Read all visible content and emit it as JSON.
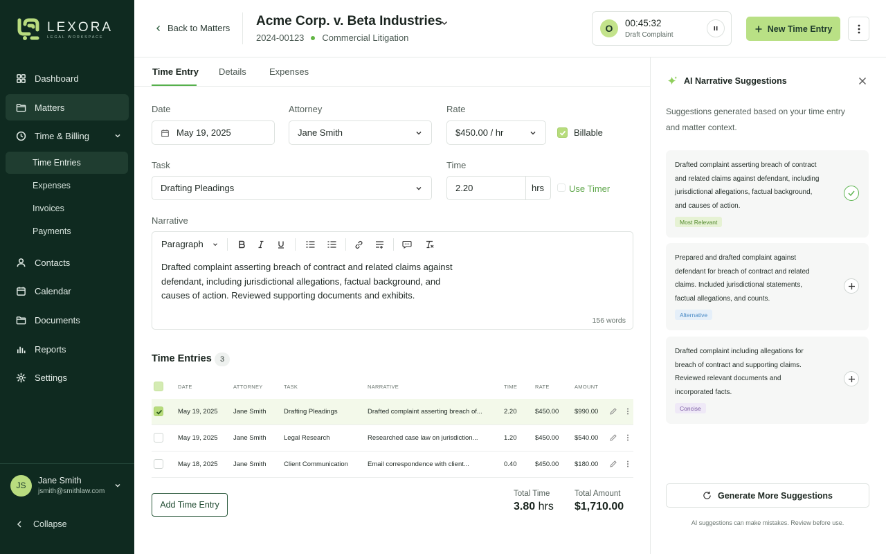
{
  "brand": {
    "name": "LEXORA",
    "tagline": "LEGAL WORKSPACE"
  },
  "nav": [
    {
      "label": "Dashboard",
      "icon": "grid-icon"
    },
    {
      "label": "Matters",
      "icon": "folder-icon",
      "active": true
    },
    {
      "label": "Time & Billing",
      "icon": "clock-icon",
      "expanded": true
    },
    {
      "label": "Contacts",
      "icon": "user-icon"
    },
    {
      "label": "Calendar",
      "icon": "calendar-icon"
    },
    {
      "label": "Documents",
      "icon": "folder-icon"
    },
    {
      "label": "Reports",
      "icon": "bar-chart-icon"
    },
    {
      "label": "Settings",
      "icon": "gear-icon"
    }
  ],
  "subnav": [
    {
      "label": "Time Entries",
      "active": true
    },
    {
      "label": "Expenses"
    },
    {
      "label": "Invoices"
    },
    {
      "label": "Payments"
    }
  ],
  "user": {
    "initials": "JS",
    "name": "Jane Smith",
    "email": "jsmith@smithlaw.com"
  },
  "collapse_label": "Collapse",
  "header": {
    "back_label": "Back to Matters",
    "matter_title": "Acme Corp. v. Beta Industries",
    "matter_number": "2024-00123",
    "practice_area": "Commercial Litigation",
    "timer": {
      "badge": "O",
      "time": "00:45:32",
      "description": "Draft Complaint"
    },
    "new_entry_label": "New Time Entry"
  },
  "tabs": [
    {
      "label": "Time Entry",
      "active": true
    },
    {
      "label": "Details"
    },
    {
      "label": "Expenses"
    }
  ],
  "form": {
    "date_label": "Date",
    "date_value": "May 19, 2025",
    "attorney_label": "Attorney",
    "attorney_value": "Jane Smith",
    "rate_label": "Rate",
    "rate_value": "$450.00 / hr",
    "billable_label": "Billable",
    "billable": true,
    "task_label": "Task",
    "task_value": "Drafting Pleadings",
    "time_label": "Time",
    "time_value": "2.20",
    "time_unit": "hrs",
    "use_timer_label": "Use Timer",
    "use_timer": false,
    "narrative_label": "Narrative",
    "paragraph_style": "Paragraph",
    "narrative_text": "Drafted complaint asserting breach of contract and related claims against\ndefendant, including jurisdictional allegations, factual background, and\ncauses of action. Reviewed supporting documents and exhibits.",
    "word_count": "156 words"
  },
  "entries": {
    "title": "Time Entries",
    "count": "3",
    "columns": [
      "DATE",
      "ATTORNEY",
      "TASK",
      "NARRATIVE",
      "TIME",
      "RATE",
      "AMOUNT"
    ],
    "rows": [
      {
        "checked": true,
        "date": "May 19, 2025",
        "attorney": "Jane Smith",
        "task": "Drafting Pleadings",
        "narrative": "Drafted complaint asserting breach of...",
        "time": "2.20",
        "rate": "$450.00",
        "amount": "$990.00"
      },
      {
        "checked": false,
        "date": "May 19, 2025",
        "attorney": "Jane Smith",
        "task": "Legal Research",
        "narrative": "Researched case law on jurisdiction...",
        "time": "1.20",
        "rate": "$450.00",
        "amount": "$540.00"
      },
      {
        "checked": false,
        "date": "May 18, 2025",
        "attorney": "Jane Smith",
        "task": "Client Communication",
        "narrative": "Email correspondence with client...",
        "time": "0.40",
        "rate": "$450.00",
        "amount": "$180.00"
      }
    ],
    "add_label": "Add Time Entry",
    "total_time_label": "Total Time",
    "total_time_value": "3.80",
    "total_time_unit": "hrs",
    "total_amount_label": "Total Amount",
    "total_amount_value": "$1,710.00"
  },
  "ai_panel": {
    "title": "AI Narrative Suggestions",
    "description": "Suggestions generated based on your time entry and matter context.",
    "suggestions": [
      {
        "text": "Drafted complaint asserting breach of contract and related claims against defendant, including jurisdictional allegations, factual background, and causes of action.",
        "tag": "Most Relevant",
        "selected": true
      },
      {
        "text": "Prepared and drafted complaint against defendant for breach of contract and related claims. Included jurisdictional statements, factual allegations, and counts.",
        "tag": "Alternative"
      },
      {
        "text": "Drafted complaint including allegations for breach of contract and supporting claims. Reviewed relevant documents and incorporated facts.",
        "tag": "Concise"
      }
    ],
    "generate_label": "Generate More Suggestions",
    "disclaimer": "AI suggestions can make mistakes. Review before use."
  },
  "colors": {
    "sidebar": "#0f2a20",
    "accent": "#b9e085",
    "active_nav": "#1f3d30",
    "brand_green": "#56b04c"
  }
}
